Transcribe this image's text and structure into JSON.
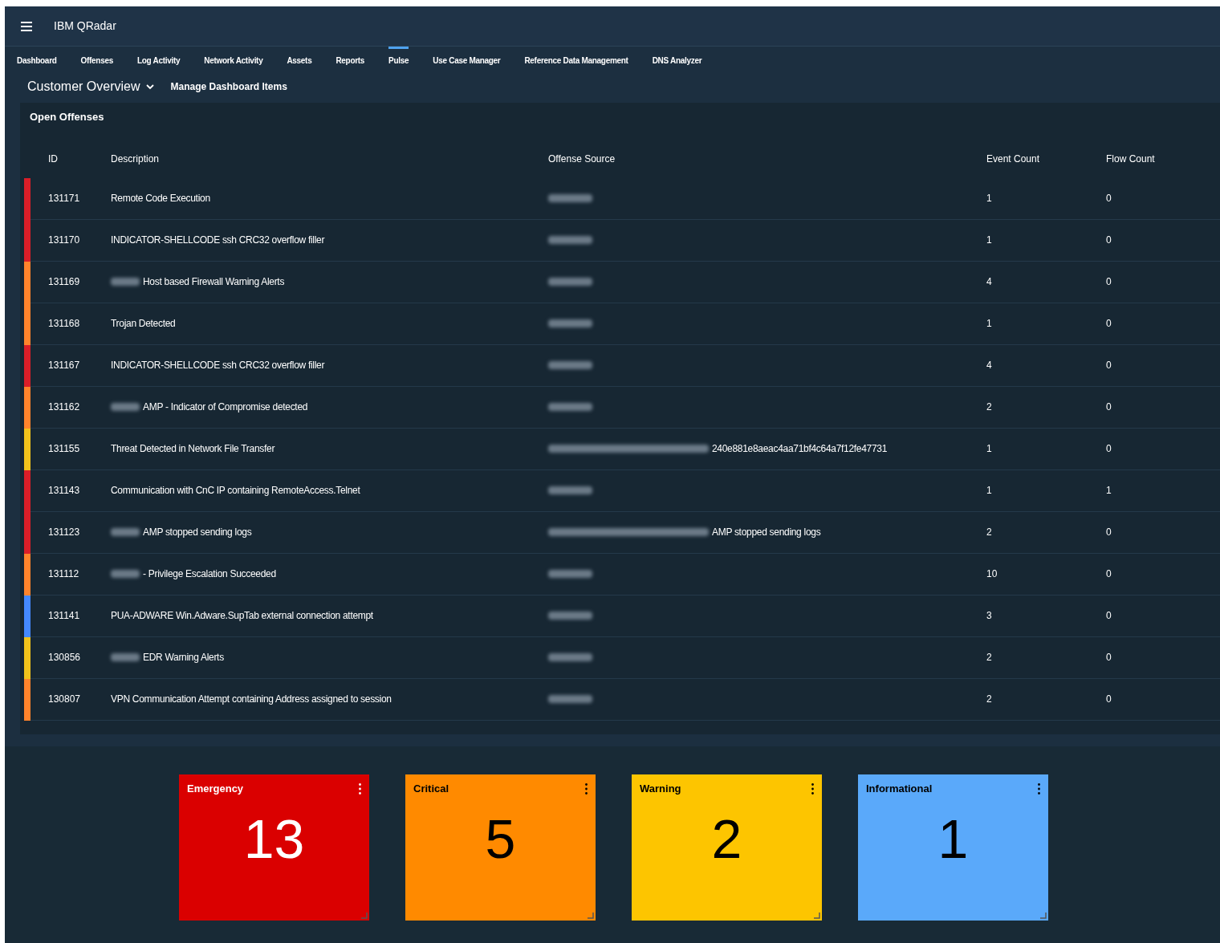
{
  "header": {
    "title": "IBM QRadar"
  },
  "tabs": [
    {
      "label": "Dashboard",
      "selected": false
    },
    {
      "label": "Offenses",
      "selected": false
    },
    {
      "label": "Log Activity",
      "selected": false
    },
    {
      "label": "Network Activity",
      "selected": false
    },
    {
      "label": "Assets",
      "selected": false
    },
    {
      "label": "Reports",
      "selected": false
    },
    {
      "label": "Pulse",
      "selected": true
    },
    {
      "label": "Use Case Manager",
      "selected": false
    },
    {
      "label": "Reference Data Management",
      "selected": false
    },
    {
      "label": "DNS Analyzer",
      "selected": false
    }
  ],
  "dashboard": {
    "title": "Customer Overview",
    "manage_link": "Manage Dashboard Items"
  },
  "offenses": {
    "title": "Open Offenses",
    "columns": [
      "ID",
      "Description",
      "Offense Source",
      "Event Count",
      "Flow Count"
    ],
    "rows": [
      {
        "id": "131171",
        "color": "#da1e28",
        "description": {
          "redacted": false,
          "text": "Remote Code Execution"
        },
        "source": {
          "redacted": true
        },
        "event_count": "1",
        "flow_count": "0"
      },
      {
        "id": "131170",
        "color": "#da1e28",
        "description": {
          "redacted": false,
          "text": "INDICATOR-SHELLCODE ssh CRC32 overflow filler"
        },
        "source": {
          "redacted": true
        },
        "event_count": "1",
        "flow_count": "0"
      },
      {
        "id": "131169",
        "color": "#ff832b",
        "description": {
          "redacted": true,
          "text": "Host based Firewall Warning Alerts"
        },
        "source": {
          "redacted": true
        },
        "event_count": "4",
        "flow_count": "0"
      },
      {
        "id": "131168",
        "color": "#ff832b",
        "description": {
          "redacted": false,
          "text": "Trojan Detected"
        },
        "source": {
          "redacted": true
        },
        "event_count": "1",
        "flow_count": "0"
      },
      {
        "id": "131167",
        "color": "#da1e28",
        "description": {
          "redacted": false,
          "text": "INDICATOR-SHELLCODE ssh CRC32 overflow filler"
        },
        "source": {
          "redacted": true
        },
        "event_count": "4",
        "flow_count": "0"
      },
      {
        "id": "131162",
        "color": "#ff832b",
        "description": {
          "redacted": true,
          "text": "AMP - Indicator of Compromise detected"
        },
        "source": {
          "redacted": true
        },
        "event_count": "2",
        "flow_count": "0"
      },
      {
        "id": "131155",
        "color": "#f1c21b",
        "description": {
          "redacted": false,
          "text": "Threat Detected in Network File Transfer"
        },
        "source": {
          "redacted": true,
          "text": "240e881e8aeac4aa71bf4c64a7f12fe47731"
        },
        "event_count": "1",
        "flow_count": "0"
      },
      {
        "id": "131143",
        "color": "#da1e28",
        "description": {
          "redacted": false,
          "text": "Communication with CnC IP containing RemoteAccess.Telnet"
        },
        "source": {
          "redacted": true
        },
        "event_count": "1",
        "flow_count": "1"
      },
      {
        "id": "131123",
        "color": "#da1e28",
        "description": {
          "redacted": true,
          "text": "AMP stopped sending logs"
        },
        "source": {
          "redacted": true,
          "text": "AMP stopped sending logs"
        },
        "event_count": "2",
        "flow_count": "0"
      },
      {
        "id": "131112",
        "color": "#ff832b",
        "description": {
          "redacted": true,
          "text": "- Privilege Escalation Succeeded"
        },
        "source": {
          "redacted": true
        },
        "event_count": "10",
        "flow_count": "0"
      },
      {
        "id": "131141",
        "color": "#4589ff",
        "description": {
          "redacted": false,
          "text": "PUA-ADWARE Win.Adware.SupTab external connection attempt"
        },
        "source": {
          "redacted": true
        },
        "event_count": "3",
        "flow_count": "0"
      },
      {
        "id": "130856",
        "color": "#f1c21b",
        "description": {
          "redacted": true,
          "text": "EDR Warning Alerts"
        },
        "source": {
          "redacted": true
        },
        "event_count": "2",
        "flow_count": "0"
      },
      {
        "id": "130807",
        "color": "#ff832b",
        "description": {
          "redacted": false,
          "text": "VPN Communication Attempt containing Address assigned to session"
        },
        "source": {
          "redacted": true
        },
        "event_count": "2",
        "flow_count": "0"
      }
    ]
  },
  "tiles": [
    {
      "label": "Emergency",
      "count": "13",
      "color": "#da0000",
      "dark_text": false
    },
    {
      "label": "Critical",
      "count": "5",
      "color": "#ff8a00",
      "dark_text": true
    },
    {
      "label": "Warning",
      "count": "2",
      "color": "#fdc500",
      "dark_text": true
    },
    {
      "label": "Informational",
      "count": "1",
      "color": "#5aa9fa",
      "dark_text": true
    }
  ]
}
